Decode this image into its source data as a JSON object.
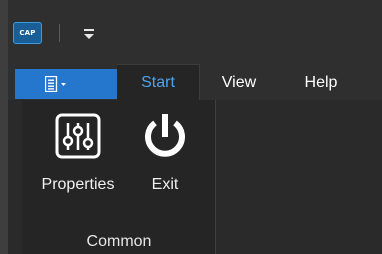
{
  "app": {
    "icon_text": "CAP"
  },
  "quick_access": {
    "icon": "customize-quick-access-icon"
  },
  "file_tab": {
    "icon": "application-menu-icon"
  },
  "tabs": [
    {
      "label": "Start",
      "active": true
    },
    {
      "label": "View",
      "active": false
    },
    {
      "label": "Help",
      "active": false
    }
  ],
  "ribbon": {
    "groups": [
      {
        "label": "Common",
        "buttons": [
          {
            "label": "Properties",
            "icon": "sliders-icon"
          },
          {
            "label": "Exit",
            "icon": "power-icon"
          }
        ]
      }
    ]
  },
  "colors": {
    "accent": "#2477cc",
    "active_tab_text": "#4da3f0",
    "background": "#2d2d2d"
  }
}
